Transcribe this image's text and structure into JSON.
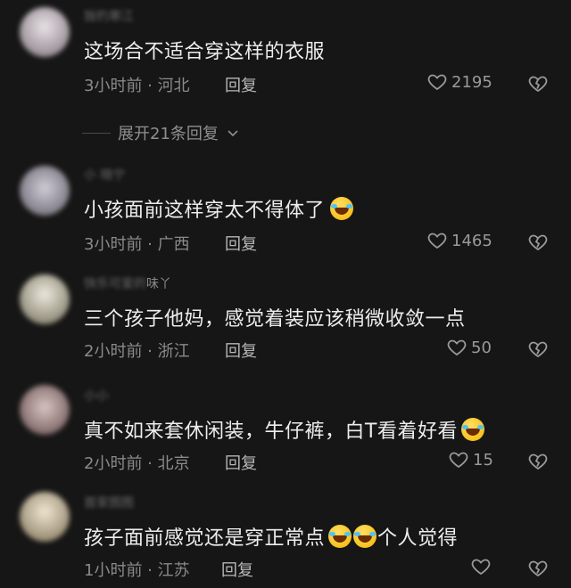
{
  "comments": [
    {
      "username": "独钓寒江",
      "text": "这场合不适合穿这样的衣服",
      "emoji_count": 0,
      "suffix": "",
      "time": "3小时前",
      "location": "河北",
      "reply_label": "回复",
      "likes": "2195",
      "avatar_colors": [
        "#d8d2d6",
        "#8a7f86"
      ]
    },
    {
      "username": "小 晓宁",
      "text": "小孩面前这样穿太不得体了",
      "emoji_count": 1,
      "suffix": "",
      "time": "3小时前",
      "location": "广西",
      "reply_label": "回复",
      "likes": "1465",
      "avatar_colors": [
        "#c7c2cc",
        "#6d6a73"
      ]
    },
    {
      "username": "快乐可爱的",
      "username_tail": "味丫",
      "text": "三个孩子他妈，感觉着装应该稍微收敛一点",
      "emoji_count": 0,
      "suffix": "",
      "time": "2小时前",
      "location": "浙江",
      "reply_label": "回复",
      "likes": "50",
      "avatar_colors": [
        "#e0dccf",
        "#7a7560"
      ]
    },
    {
      "username": "小小",
      "text": "真不如来套休闲装，牛仔裤，白T看着好看",
      "emoji_count": 1,
      "suffix": "",
      "time": "2小时前",
      "location": "北京",
      "reply_label": "回复",
      "likes": "15",
      "avatar_colors": [
        "#c9b8b8",
        "#6e5555"
      ]
    },
    {
      "username": "首家图图",
      "text": "孩子面前感觉还是穿正常点",
      "emoji_count": 2,
      "suffix": "个人觉得",
      "time": "1小时前",
      "location": "江苏",
      "reply_label": "回复",
      "likes": "",
      "avatar_colors": [
        "#e6dcc8",
        "#8a7a60"
      ]
    }
  ],
  "expand_label": "展开21条回复",
  "icons": {
    "like": "heart-outline-icon",
    "dislike": "broken-heart-icon",
    "chevron": "chevron-down-icon",
    "emoji": "laughing-crying-emoji-icon"
  },
  "colors": {
    "background": "#161616",
    "text": "#ededed",
    "meta": "#8a8a8a"
  }
}
